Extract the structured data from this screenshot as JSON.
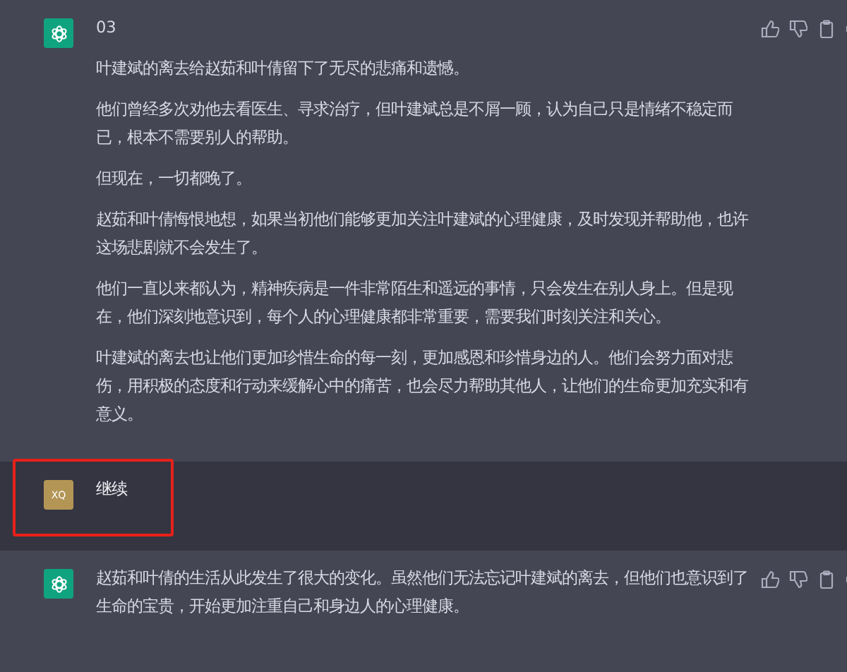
{
  "messages": [
    {
      "kind": "assistant",
      "paragraphs": [
        "03",
        "叶建斌的离去给赵茹和叶倩留下了无尽的悲痛和遗憾。",
        "他们曾经多次劝他去看医生、寻求治疗，但叶建斌总是不屑一顾，认为自己只是情绪不稳定而已，根本不需要别人的帮助。",
        "但现在，一切都晚了。",
        "赵茹和叶倩悔恨地想，如果当初他们能够更加关注叶建斌的心理健康，及时发现并帮助他，也许这场悲剧就不会发生了。",
        "他们一直以来都认为，精神疾病是一件非常陌生和遥远的事情，只会发生在别人身上。但是现在，他们深刻地意识到，每个人的心理健康都非常重要，需要我们时刻关注和关心。",
        "叶建斌的离去也让他们更加珍惜生命的每一刻，更加感恩和珍惜身边的人。他们会努力面对悲伤，用积极的态度和行动来缓解心中的痛苦，也会尽力帮助其他人，让他们的生命更加充实和有意义。"
      ]
    },
    {
      "kind": "user",
      "avatar": "XQ",
      "highlighted": true,
      "paragraphs": [
        "继续"
      ]
    },
    {
      "kind": "assistant",
      "paragraphs": [
        "赵茹和叶倩的生活从此发生了很大的变化。虽然他们无法忘记叶建斌的离去，但他们也意识到了生命的宝贵，开始更加注重自己和身边人的心理健康。"
      ]
    }
  ]
}
